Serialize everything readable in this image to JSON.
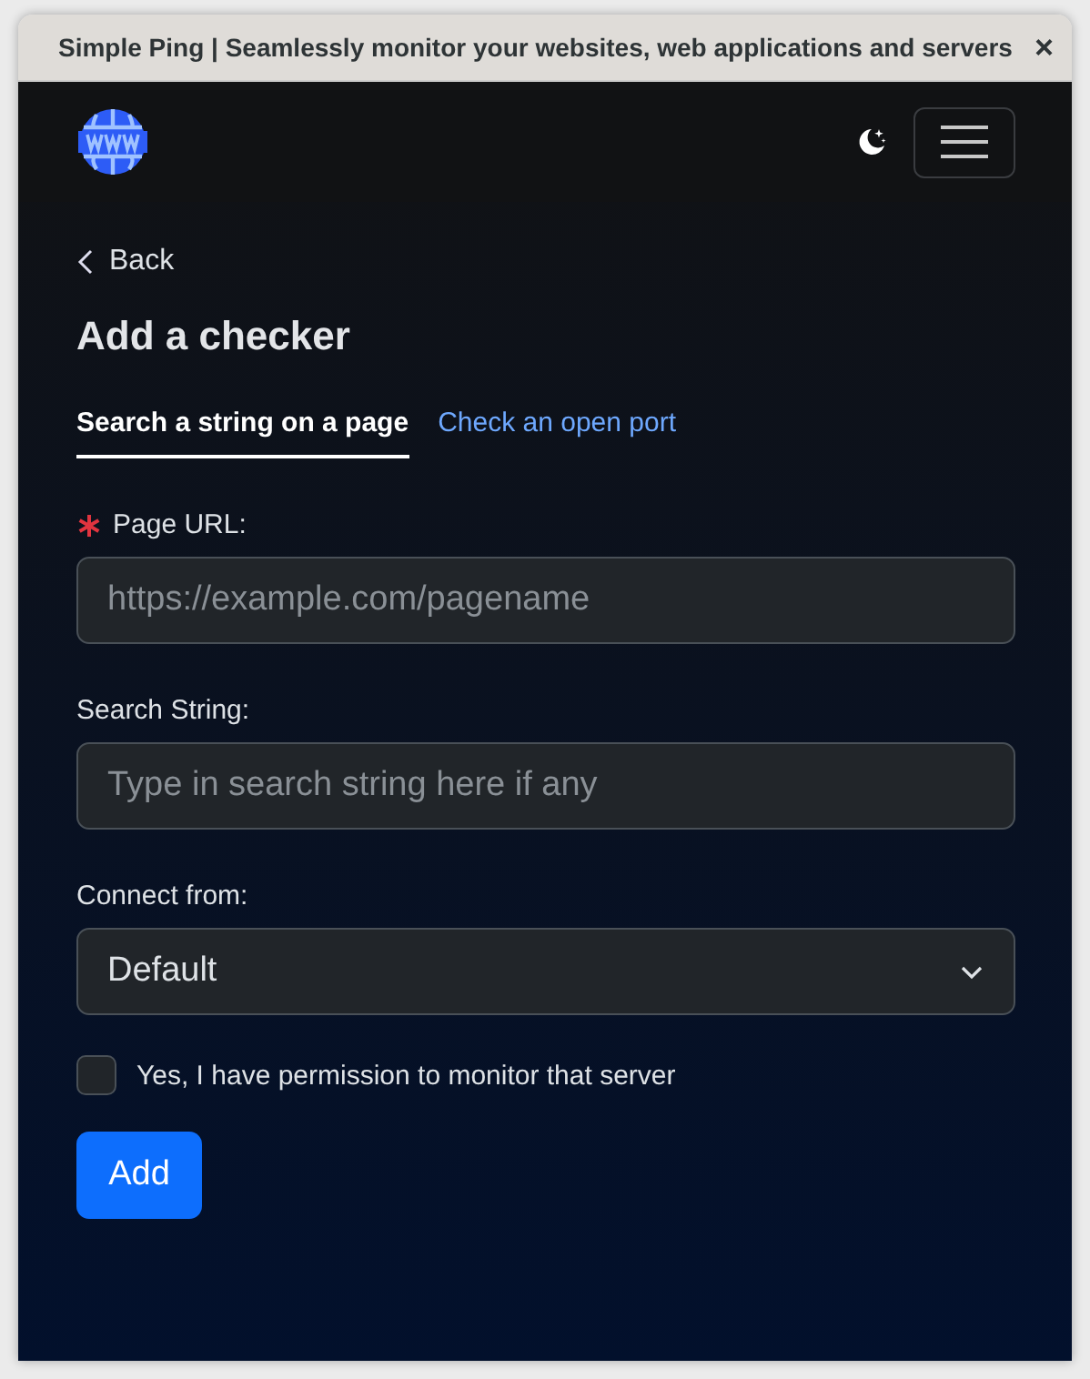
{
  "window": {
    "title": "Simple Ping | Seamlessly monitor your websites, web applications and servers",
    "close": "×"
  },
  "back": {
    "label": "Back"
  },
  "heading": "Add a checker",
  "tabs": [
    {
      "label": "Search a string on a page",
      "selected": true
    },
    {
      "label": "Check an open port",
      "selected": false
    }
  ],
  "fields": [
    {
      "kind": "text",
      "label": "Page URL:",
      "required": true,
      "placeholder": "https://example.com/pagename"
    },
    {
      "kind": "text",
      "label": "Search String:",
      "required": false,
      "placeholder": "Type in search string here if any"
    },
    {
      "kind": "select",
      "label": "Connect from:",
      "required": false,
      "value": "Default"
    }
  ],
  "permission": {
    "label": "Yes, I have permission to monitor that server",
    "checked": false
  },
  "submit": "Add"
}
